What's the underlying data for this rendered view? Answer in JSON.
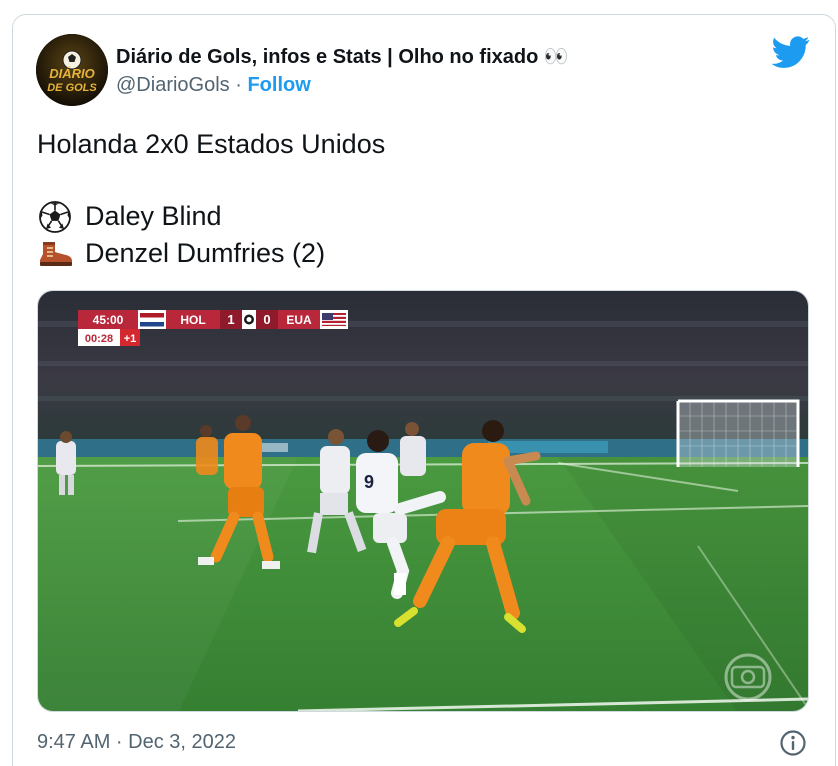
{
  "author": {
    "display_name": "Diário de Gols, infos e Stats | Olho no fixado 👀",
    "handle": "@DiarioGols",
    "separator": "·",
    "follow_label": "Follow",
    "avatar_text_top": "DIÁRIO",
    "avatar_text_bottom": "DE GOLS"
  },
  "tweet": {
    "headline": "Holanda 2x0 Estados Unidos",
    "goal_line": "Daley Blind",
    "assist_line": "Denzel Dumfries (2)",
    "goal_icon": "soccer-ball-icon",
    "assist_icon": "boot-icon"
  },
  "scoreboard": {
    "clock": "45:00",
    "home_team": "HOL",
    "home_score": "1",
    "away_score": "0",
    "away_team": "EUA",
    "added_time": "00:28",
    "added_minutes": "+1"
  },
  "footer": {
    "timestamp": "9:47 AM · Dec 3, 2022",
    "info_icon": "info-icon"
  },
  "colors": {
    "twitter_blue": "#1d9bf0",
    "text_primary": "#0f1419",
    "text_secondary": "#536471",
    "pitch_green": "#3f8f3a",
    "netherlands_orange": "#f08a1c"
  }
}
